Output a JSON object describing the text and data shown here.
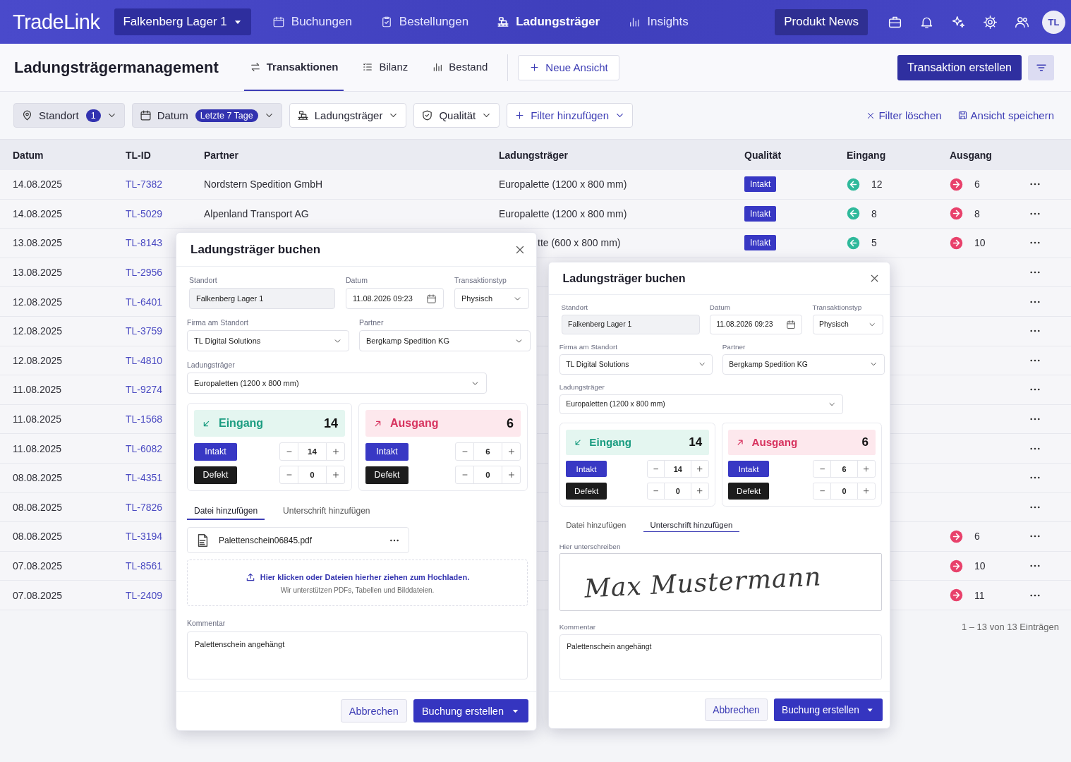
{
  "topbar": {
    "logo": "TradeLink",
    "location": "Falkenberg Lager 1",
    "nav": [
      {
        "label": "Buchungen",
        "selected": false
      },
      {
        "label": "Bestellungen",
        "selected": false
      },
      {
        "label": "Ladungsträger",
        "selected": true
      },
      {
        "label": "Insights",
        "selected": false
      }
    ],
    "news": "Produkt News",
    "avatar": "TL"
  },
  "page": {
    "title": "Ladungsträgermanagement",
    "tabs": [
      {
        "label": "Transaktionen",
        "selected": true
      },
      {
        "label": "Bilanz",
        "selected": false
      },
      {
        "label": "Bestand",
        "selected": false
      }
    ],
    "new_view": "Neue Ansicht",
    "create": "Transaktion erstellen"
  },
  "filters": {
    "chips": [
      {
        "label": "Standort",
        "badge": "1",
        "active": true
      },
      {
        "label": "Datum",
        "badge": "Letzte 7 Tage",
        "active": true
      },
      {
        "label": "Ladungsträger",
        "active": false
      },
      {
        "label": "Qualität",
        "active": false
      }
    ],
    "add": "Filter hinzufügen",
    "clear": "Filter löschen",
    "save": "Ansicht speichern"
  },
  "table": {
    "columns": [
      "Datum",
      "TL-ID",
      "Partner",
      "Ladungsträger",
      "Qualität",
      "Eingang",
      "Ausgang"
    ],
    "rows": [
      {
        "datum": "14.08.2025",
        "id": "TL-7382",
        "partner": "Nordstern Spedition GmbH",
        "ladungstraeger": "Europalette (1200 x 800 mm)",
        "qualitaet": "Intakt",
        "eingang": "12",
        "ausgang": "6"
      },
      {
        "datum": "14.08.2025",
        "id": "TL-5029",
        "partner": "Alpenland Transport AG",
        "ladungstraeger": "Europalette (1200 x 800 mm)",
        "qualitaet": "Intakt",
        "eingang": "8",
        "ausgang": "8"
      },
      {
        "datum": "13.08.2025",
        "id": "TL-8143",
        "ladungstraeger_cut": "tte (600 x 800 mm)",
        "qualitaet": "Intakt",
        "eingang": "5",
        "ausgang": "10"
      },
      {
        "datum": "13.08.2025",
        "id": "TL-2956"
      },
      {
        "datum": "12.08.2025",
        "id": "TL-6401"
      },
      {
        "datum": "12.08.2025",
        "id": "TL-3759"
      },
      {
        "datum": "12.08.2025",
        "id": "TL-4810"
      },
      {
        "datum": "11.08.2025",
        "id": "TL-9274"
      },
      {
        "datum": "11.08.2025",
        "id": "TL-1568"
      },
      {
        "datum": "11.08.2025",
        "id": "TL-6082"
      },
      {
        "datum": "08.08.2025",
        "id": "TL-4351"
      },
      {
        "datum": "08.08.2025",
        "id": "TL-7826"
      },
      {
        "datum": "08.08.2025",
        "id": "TL-3194",
        "ausgang": "6"
      },
      {
        "datum": "07.08.2025",
        "id": "TL-8561",
        "ausgang": "10"
      },
      {
        "datum": "07.08.2025",
        "id": "TL-2409",
        "ausgang": "11"
      }
    ],
    "footer": "1 – 13 von 13 Einträgen"
  },
  "dialogs": [
    {
      "title": "Ladungsträger buchen",
      "fields": [
        {
          "label": "Standort",
          "value": "Falkenberg Lager 1",
          "kind": "readonly"
        },
        {
          "label": "Datum",
          "value": "11.08.2026 09:23",
          "kind": "date"
        },
        {
          "label": "Transaktionstyp",
          "value": "Physisch",
          "kind": "select"
        },
        {
          "label": "Firma am Standort",
          "value": "TL Digital Solutions",
          "kind": "select"
        },
        {
          "label": "Partner",
          "value": "Bergkamp Spedition KG",
          "kind": "select"
        },
        {
          "label": "Ladungsträger",
          "value": "Europaletten (1200 x 800 mm)",
          "kind": "select"
        }
      ],
      "panels": [
        {
          "kind": "in",
          "label": "Eingang",
          "total": "14",
          "rows": [
            {
              "kind": "intakt",
              "label": "Intakt",
              "value": "14"
            },
            {
              "kind": "defekt",
              "label": "Defekt",
              "value": "0"
            }
          ]
        },
        {
          "kind": "out",
          "label": "Ausgang",
          "total": "6",
          "rows": [
            {
              "kind": "intakt",
              "label": "Intakt",
              "value": "6"
            },
            {
              "kind": "defekt",
              "label": "Defekt",
              "value": "0"
            }
          ]
        }
      ],
      "tabs": [
        {
          "label": "Datei hinzufügen",
          "selected": true
        },
        {
          "label": "Unterschrift hinzufügen",
          "selected": false
        }
      ],
      "attachment": {
        "kind": "file",
        "file": "Palettenschein06845.pdf",
        "upload": "Hier klicken oder Dateien hierher ziehen zum Hochladen.",
        "hint": "Wir unterstützen PDFs, Tabellen und Bilddateien."
      },
      "comment_label": "Kommentar",
      "comment": "Palettenschein angehängt",
      "cancel": "Abbrechen",
      "submit": "Buchung erstellen"
    },
    {
      "title": "Ladungsträger buchen",
      "fields": [
        {
          "label": "Standort",
          "value": "Falkenberg Lager 1",
          "kind": "readonly"
        },
        {
          "label": "Datum",
          "value": "11.08.2026 09:23",
          "kind": "date"
        },
        {
          "label": "Transaktionstyp",
          "value": "Physisch",
          "kind": "select"
        },
        {
          "label": "Firma am Standort",
          "value": "TL Digital Solutions",
          "kind": "select"
        },
        {
          "label": "Partner",
          "value": "Bergkamp Spedition KG",
          "kind": "select"
        },
        {
          "label": "Ladungsträger",
          "value": "Europaletten (1200 x 800 mm)",
          "kind": "select"
        }
      ],
      "panels": [
        {
          "kind": "in",
          "label": "Eingang",
          "total": "14",
          "rows": [
            {
              "kind": "intakt",
              "label": "Intakt",
              "value": "14"
            },
            {
              "kind": "defekt",
              "label": "Defekt",
              "value": "0"
            }
          ]
        },
        {
          "kind": "out",
          "label": "Ausgang",
          "total": "6",
          "rows": [
            {
              "kind": "intakt",
              "label": "Intakt",
              "value": "6"
            },
            {
              "kind": "defekt",
              "label": "Defekt",
              "value": "0"
            }
          ]
        }
      ],
      "tabs": [
        {
          "label": "Datei hinzufügen",
          "selected": false
        },
        {
          "label": "Unterschrift hinzufügen",
          "selected": true
        }
      ],
      "attachment": {
        "kind": "signature",
        "label": "Hier unterschreiben",
        "signature": "Max Mustermann"
      },
      "comment_label": "Kommentar",
      "comment": "Palettenschein angehängt",
      "cancel": "Abbrechen",
      "submit": "Buchung erstellen"
    }
  ]
}
